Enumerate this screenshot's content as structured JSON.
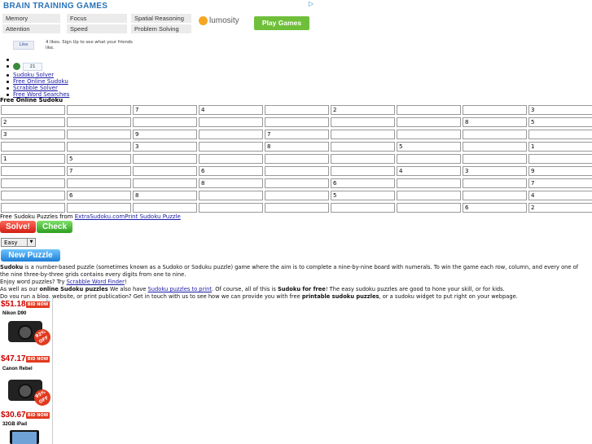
{
  "top_ad": {
    "title": "BRAIN TRAINING GAMES",
    "categories": [
      "Memory",
      "Focus",
      "Spatial Reasoning",
      "Attention",
      "Speed",
      "Problem Solving"
    ],
    "brand": "lumosity",
    "cta": "Play Games",
    "adchoices": "▷"
  },
  "social": {
    "like_label": "Like",
    "like_text": "4 likes. Sign Up to see what your friends like.",
    "gplus_count": "21"
  },
  "nav": {
    "links": [
      "Sudoku Solver",
      "Free Online Sudoku",
      "Scrabble Solver",
      "Free Word Searches"
    ]
  },
  "page_title": "Free Online Sudoku",
  "grid": [
    [
      "",
      "",
      "7",
      "4",
      "",
      "2",
      "",
      "",
      "3"
    ],
    [
      "2",
      "",
      "",
      "",
      "",
      "",
      "",
      "8",
      "5"
    ],
    [
      "3",
      "",
      "9",
      "",
      "7",
      "",
      "",
      "",
      ""
    ],
    [
      "",
      "",
      "3",
      "",
      "8",
      "",
      "5",
      "",
      "1"
    ],
    [
      "1",
      "5",
      "",
      "",
      "",
      "",
      "",
      "",
      ""
    ],
    [
      "",
      "7",
      "",
      "6",
      "",
      "",
      "4",
      "3",
      "9"
    ],
    [
      "",
      "",
      "",
      "8",
      "",
      "6",
      "",
      "",
      "7"
    ],
    [
      "",
      "6",
      "8",
      "",
      "",
      "5",
      "",
      "",
      "4"
    ],
    [
      "",
      "",
      "",
      "",
      "",
      "",
      "",
      "6",
      "2"
    ]
  ],
  "credit": {
    "prefix": "Free Sudoku Puzzles from ",
    "source_link": "ExtraSudoku.com",
    "print_link": "Print Sudoku Puzzle"
  },
  "buttons": {
    "solve": "Solve!",
    "check": "Check",
    "new_puzzle": "New Puzzle"
  },
  "difficulty": {
    "selected": "Easy"
  },
  "description": {
    "p1_bold": "Sudoku",
    "p1_rest": " is a number-based puzzle (sometimes known as a Sudoko or Soduku puzzle) game where the aim is to complete a nine-by-nine board with numerals. To win the game each row, column, and every one of the nine three-by-three grids contains every digits from one to nine.",
    "p2_text": "Enjoy word puzzles? Try ",
    "p2_link": "Scrabble Word Finder",
    "p2_end": "!",
    "p3_a": "As well as our ",
    "p3_bold1": "online Sudoku puzzles",
    "p3_b": " We also have ",
    "p3_link": "Sudoku puzzles to print",
    "p3_c": ". Of course, all of this is ",
    "p3_bold2": "Sudoku for free",
    "p3_d": "! The easy sudoku puzzles are good to hone your skill, or for kids.",
    "p4_a": "Do you run a blog, website, or print publication? Get in touch with us to see how we can provide you with free ",
    "p4_bold": "printable sudoku puzzles",
    "p4_b": ", or a sudoku widget to put right on your webpage."
  },
  "side_ad": {
    "items": [
      {
        "price": "$51.18",
        "bid": "BID NOW",
        "name": "Nikon D90",
        "off": "92% OFF"
      },
      {
        "price": "$47.17",
        "bid": "BID NOW",
        "name": "Canon Rebel",
        "off": "95% OFF"
      },
      {
        "price": "$30.67",
        "bid": "BID NOW",
        "name": "32GB iPad"
      }
    ]
  }
}
